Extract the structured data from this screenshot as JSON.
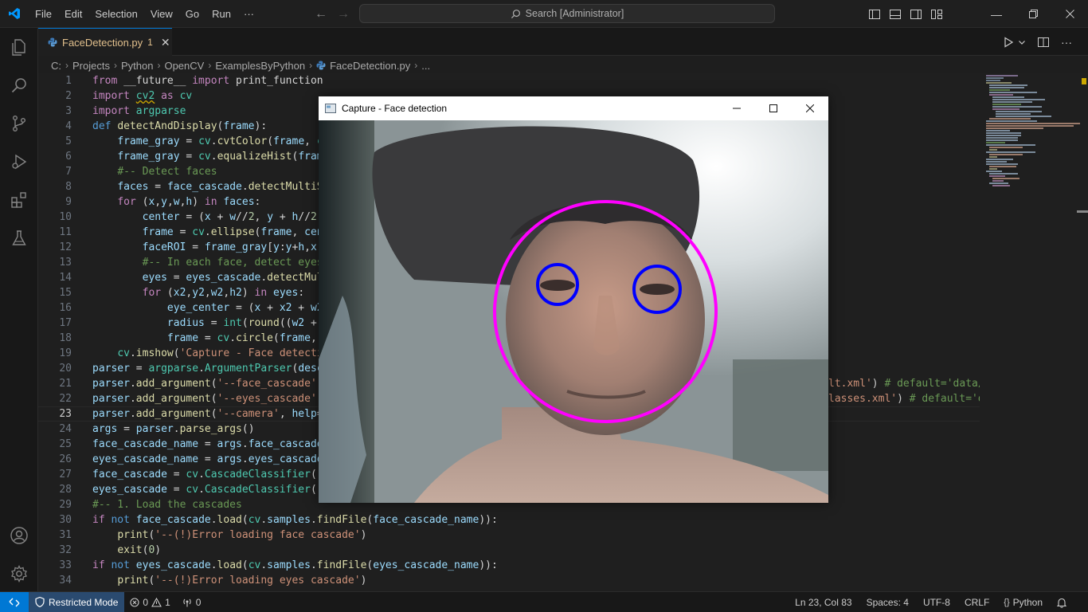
{
  "titlebar": {
    "menu": [
      "File",
      "Edit",
      "Selection",
      "View",
      "Go",
      "Run",
      "···"
    ],
    "search": "Search [Administrator]"
  },
  "tab": {
    "name": "FaceDetection.py",
    "problems": "1"
  },
  "breadcrumb": [
    "C:",
    "Projects",
    "Python",
    "OpenCV",
    "ExamplesByPython",
    "FaceDetection.py",
    "..."
  ],
  "capture": {
    "title": "Capture - Face detection"
  },
  "status": {
    "restricted": "Restricted Mode",
    "errors": "0",
    "warnings": "1",
    "ports": "0",
    "position": "Ln 23, Col 83",
    "spaces": "Spaces: 4",
    "encoding": "UTF-8",
    "eol": "CRLF",
    "language": "Python"
  },
  "colors": {
    "accent": "#0078d4",
    "face_ellipse": "#ff00ff",
    "eye_circle": "#0000ff"
  }
}
